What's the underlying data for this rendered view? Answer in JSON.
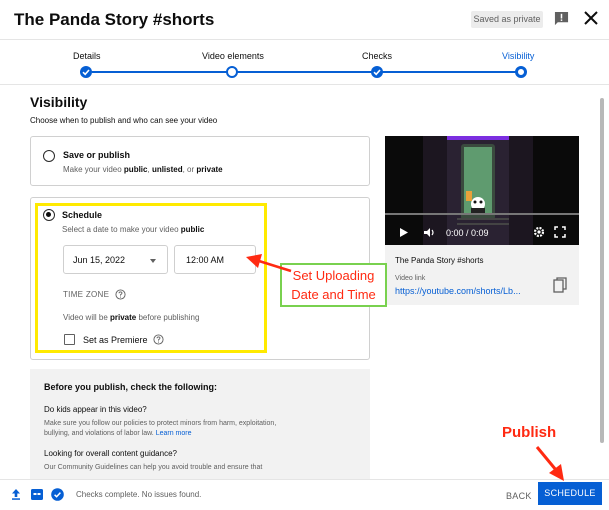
{
  "header": {
    "title": "The Panda Story #shorts",
    "saved_badge": "Saved as private"
  },
  "stepper": {
    "steps": [
      {
        "label": "Details",
        "state": "done"
      },
      {
        "label": "Video elements",
        "state": "current-ring"
      },
      {
        "label": "Checks",
        "state": "done"
      },
      {
        "label": "Visibility",
        "state": "active"
      }
    ]
  },
  "visibility": {
    "title": "Visibility",
    "subtitle": "Choose when to publish and who can see your video",
    "save_or_publish": {
      "title": "Save or publish",
      "desc_prefix": "Make your video ",
      "public": "public",
      "sep1": ", ",
      "unlisted": "unlisted",
      "sep2": ", or ",
      "private": "private"
    },
    "schedule": {
      "title": "Schedule",
      "desc_prefix": "Select a date to make your video ",
      "public": "public",
      "date_value": "Jun 15, 2022",
      "time_value": "12:00 AM",
      "time_zone_label": "TIME ZONE",
      "private_prefix": "Video will be ",
      "private_word": "private",
      "private_suffix": " before publishing",
      "premiere_label": "Set as Premiere"
    }
  },
  "video_preview": {
    "time_display": "0:00 / 0:09",
    "video_title": "The Panda Story #shorts",
    "link_label": "Video link",
    "link_url": "https://youtube.com/shorts/Lb..."
  },
  "before_publish": {
    "heading": "Before you publish, check the following:",
    "q1": "Do kids appear in this video?",
    "q1_text_line1": "Make sure you follow our policies to protect minors from harm, exploitation,",
    "q1_text_line2": "bullying, and violations of labor law. ",
    "learn_more": "Learn more",
    "q2": "Looking for overall content guidance?",
    "q2_text": "Our Community Guidelines can help you avoid trouble and ensure that"
  },
  "footer": {
    "status": "Checks complete. No issues found.",
    "back_label": "BACK",
    "schedule_label": "SCHEDULE"
  },
  "annotations": {
    "line1": "Set Uploading",
    "line2": "Date and Time",
    "publish": "Publish"
  },
  "colors": {
    "accent": "#065fd4",
    "highlight_yellow": "#ffea00",
    "annotation_red": "#ff2a12",
    "annotation_green": "#79d14f"
  }
}
